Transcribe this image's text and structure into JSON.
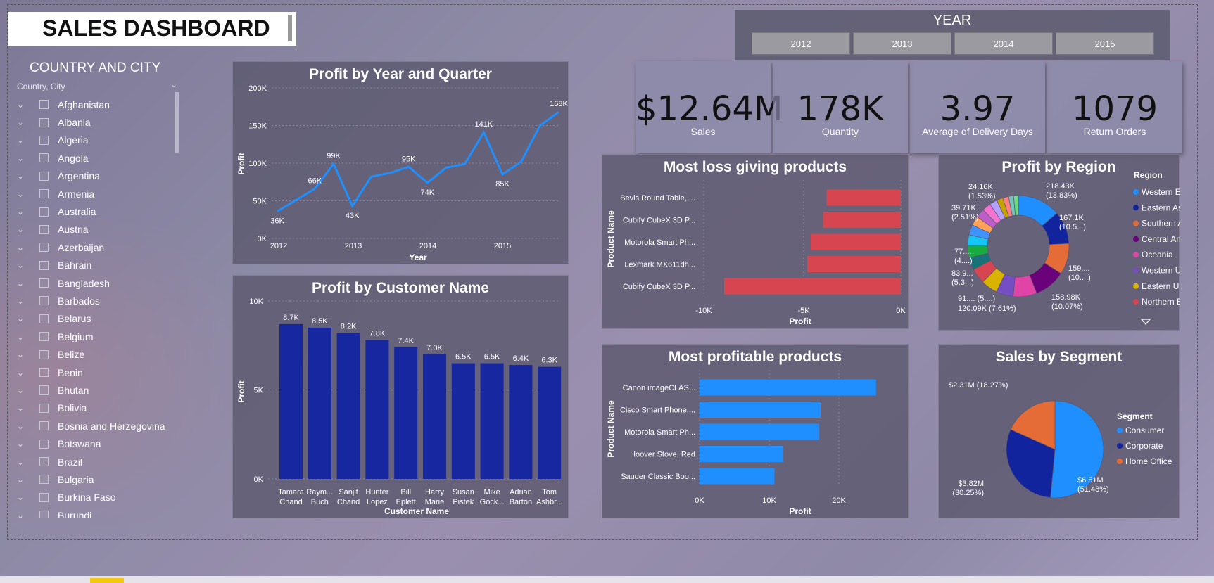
{
  "title": "SALES DASHBOARD",
  "slicer": {
    "title": "COUNTRY AND CITY",
    "field": "Country, City",
    "items": [
      "Afghanistan",
      "Albania",
      "Algeria",
      "Angola",
      "Argentina",
      "Armenia",
      "Australia",
      "Austria",
      "Azerbaijan",
      "Bahrain",
      "Bangladesh",
      "Barbados",
      "Belarus",
      "Belgium",
      "Belize",
      "Benin",
      "Bhutan",
      "Bolivia",
      "Bosnia and Herzegovina",
      "Botswana",
      "Brazil",
      "Bulgaria",
      "Burkina Faso",
      "Burundi"
    ]
  },
  "year": {
    "title": "YEAR",
    "options": [
      "2012",
      "2013",
      "2014",
      "2015"
    ]
  },
  "kpis": [
    {
      "value": "$12.64M",
      "label": "Sales"
    },
    {
      "value": "178K",
      "label": "Quantity"
    },
    {
      "value": "3.97",
      "label": "Average of Delivery Days"
    },
    {
      "value": "1079",
      "label": "Return Orders"
    }
  ],
  "colors": {
    "line": "#1f8fff",
    "bar_dark": "#1627a0",
    "bar_red": "#d64550",
    "bar_blue": "#1f8fff"
  },
  "chart_data": [
    {
      "type": "line",
      "title": "Profit by Year and Quarter",
      "xlabel": "Year",
      "ylabel": "Profit",
      "x_ticks": [
        "2012",
        "2013",
        "2014",
        "2015"
      ],
      "y_ticks": [
        "0K",
        "50K",
        "100K",
        "150K",
        "200K"
      ],
      "ylim": [
        0,
        200
      ],
      "values": [
        36,
        51,
        66,
        99,
        43,
        82,
        87,
        95,
        74,
        94,
        99,
        141,
        85,
        102,
        150,
        168
      ],
      "labels": [
        "36K",
        "",
        "66K",
        "99K",
        "43K",
        "",
        "",
        "95K",
        "74K",
        "",
        "",
        "141K",
        "85K",
        "",
        "",
        "168K"
      ]
    },
    {
      "type": "bar",
      "title": "Profit by Customer Name",
      "xlabel": "Customer Name",
      "ylabel": "Profit",
      "y_ticks": [
        "0K",
        "5K",
        "10K"
      ],
      "ylim": [
        0,
        10
      ],
      "categories": [
        [
          "Tamara",
          "Chand"
        ],
        [
          "Raym...",
          "Buch"
        ],
        [
          "Sanjit",
          "Chand"
        ],
        [
          "Hunter",
          "Lopez"
        ],
        [
          "Bill",
          "Eplett"
        ],
        [
          "Harry",
          "Marie"
        ],
        [
          "Susan",
          "Pistek"
        ],
        [
          "Mike",
          "Gock..."
        ],
        [
          "Adrian",
          "Barton"
        ],
        [
          "Tom",
          "Ashbr..."
        ]
      ],
      "values": [
        8.7,
        8.5,
        8.2,
        7.8,
        7.4,
        7.0,
        6.5,
        6.5,
        6.4,
        6.3
      ],
      "labels": [
        "8.7K",
        "8.5K",
        "8.2K",
        "7.8K",
        "7.4K",
        "7.0K",
        "6.5K",
        "6.5K",
        "6.4K",
        "6.3K"
      ]
    },
    {
      "type": "bar",
      "orientation": "horizontal",
      "title": "Most loss giving products",
      "xlabel": "Profit",
      "ylabel": "Product Name",
      "x_ticks": [
        "-10K",
        "-5K",
        "0K"
      ],
      "xlim": [
        -10,
        0
      ],
      "categories": [
        "Bevis Round Table, ...",
        "Cubify CubeX 3D P...",
        "Motorola Smart Ph...",
        "Lexmark MX611dh...",
        "Cubify CubeX 3D P..."
      ],
      "values": [
        -4.2,
        -4.4,
        -5.1,
        -5.3,
        -10.0
      ]
    },
    {
      "type": "bar",
      "orientation": "horizontal",
      "title": "Most profitable products",
      "xlabel": "Profit",
      "ylabel": "Product Name",
      "x_ticks": [
        "0K",
        "10K",
        "20K"
      ],
      "xlim": [
        0,
        20
      ],
      "categories": [
        "Canon imageCLAS...",
        "Cisco Smart Phone,...",
        "Motorola Smart Ph...",
        "Hoover Stove, Red",
        "Sauder Classic Boo..."
      ],
      "values": [
        25.2,
        17.3,
        17.1,
        11.9,
        10.7
      ]
    },
    {
      "type": "pie",
      "title": "Profit by Region",
      "legend_title": "Region",
      "legend": [
        "Western Euro...",
        "Eastern Asia",
        "Southern Asia",
        "Central Ameri...",
        "Oceania",
        "Western US",
        "Eastern US",
        "Northern Eur..."
      ],
      "slice_colors": [
        "#1f8fff",
        "#12239e",
        "#e66c37",
        "#6b007b",
        "#e044a7",
        "#744ec2",
        "#d9b300",
        "#d64550",
        "#197278",
        "#1aab40",
        "#15c6f4",
        "#4092ff",
        "#ffa058",
        "#be5dc9",
        "#f472d0",
        "#b5a1ff",
        "#c4a200",
        "#ff8080",
        "#72c5bb",
        "#6ddb7f"
      ],
      "values": [
        13.83,
        10.5,
        10.0,
        10.07,
        7.61,
        5.5,
        5.3,
        5.0,
        4.0,
        3.8,
        3.5,
        3.3,
        3.0,
        2.9,
        2.8,
        2.51,
        2.0,
        1.9,
        1.6,
        1.53
      ],
      "labels": [
        {
          "text": "218.43K",
          "sub": "(13.83%)"
        },
        {
          "text": "167.1K",
          "sub": "(10.5...)"
        },
        {
          "text": "159....",
          "sub": "(10....)"
        },
        {
          "text": "158.98K",
          "sub": "(10.07%)"
        },
        {
          "text": "120.09K (7.61%)",
          "sub": ""
        },
        {
          "text": "91.... (5....)",
          "sub": ""
        },
        {
          "text": "83.9...",
          "sub": "(5.3...)"
        },
        {
          "text": "77....",
          "sub": "(4....)"
        },
        {
          "text": "39.71K",
          "sub": "(2.51%)"
        },
        {
          "text": "24.16K",
          "sub": "(1.53%)"
        }
      ]
    },
    {
      "type": "pie",
      "title": "Sales by Segment",
      "legend_title": "Segment",
      "legend": [
        "Consumer",
        "Corporate",
        "Home Office"
      ],
      "slice_colors": [
        "#1f8fff",
        "#12239e",
        "#e66c37"
      ],
      "values": [
        51.48,
        30.25,
        18.27
      ],
      "labels": [
        "$6.51M (51.48%)",
        "$3.82M (30.25%)",
        "$2.31M (18.27%)"
      ],
      "labels_split": [
        [
          "$6.51M",
          "(51.48%)"
        ],
        [
          "$3.82M",
          "(30.25%)"
        ],
        [
          "$2.31M (18.27%)",
          ""
        ]
      ]
    }
  ]
}
